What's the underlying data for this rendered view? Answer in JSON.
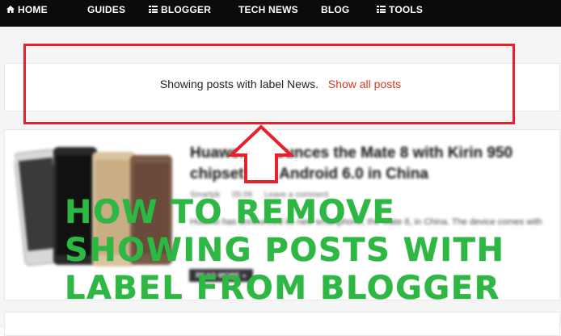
{
  "nav": {
    "items": [
      {
        "label": "HOME",
        "icon": "home-icon"
      },
      {
        "label": "GUIDES",
        "icon": null
      },
      {
        "label": "BLOGGER",
        "icon": "list-icon"
      },
      {
        "label": "TECH NEWS",
        "icon": null
      },
      {
        "label": "BLOG",
        "icon": null
      },
      {
        "label": "TOOLS",
        "icon": "list-icon"
      }
    ]
  },
  "status": {
    "message": "Showing posts with label News.",
    "link_label": "Show all posts",
    "link_color": "#d63b1f"
  },
  "highlight": {
    "frame_color": "#e8202b",
    "arrow_color": "#e8202b"
  },
  "post": {
    "title": "Huawei announces the Mate 8 with Kirin 950 chipset and Android 6.0 in China",
    "author": "Smartpk",
    "time": "05:09",
    "comments": "Leave a comment",
    "snippet": "Huawei has announced its new smartphone, the Mate 8, in China. The device comes with",
    "read_more": "READ MORE »"
  },
  "overlay": {
    "lines": [
      "HOW TO REMOVE",
      "SHOWING POSTS WITH",
      "LABEL FROM BLOGGER"
    ],
    "color": "#2db843"
  }
}
